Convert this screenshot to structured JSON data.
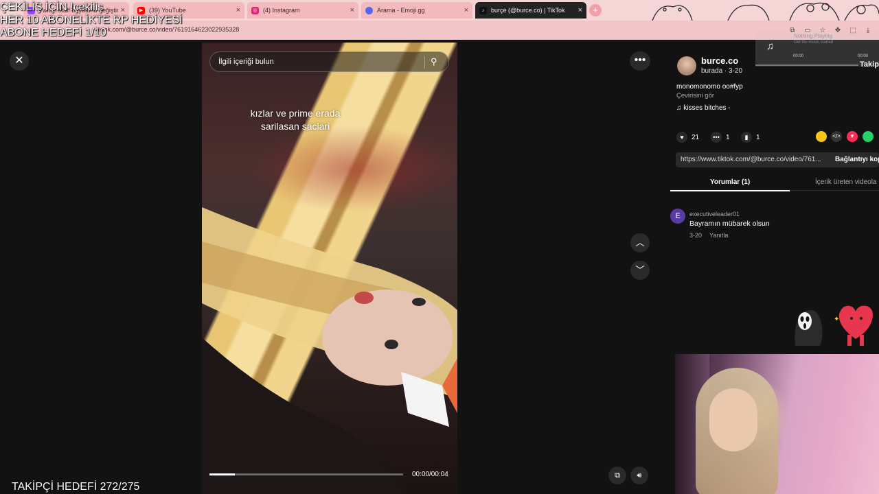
{
  "browser": {
    "tabs": [
      {
        "label": "Twitch staff boyutunu değiştir",
        "color": "#9146ff",
        "active": false
      },
      {
        "label": "(39) YouTube",
        "color": "#ff0000",
        "active": false
      },
      {
        "label": "(4) Instagram",
        "color": "#d62976",
        "active": false
      },
      {
        "label": "Arama - Emoji.gg",
        "color": "#5865f2",
        "active": false
      },
      {
        "label": "burçe (@burce.co) | TikTok",
        "color": "#111111",
        "active": true
      }
    ],
    "url": "tiktok.com/@burce.co/video/7619164623022935328",
    "close_glyph": "×",
    "new_tab": "+"
  },
  "stream_overlay": {
    "lines": [
      "ÇEKİLİŞ İÇİN !çekiliş",
      "HER 10 ABONELİKTE RP HEDİYESİ",
      "ABONE HEDEFİ 1/10"
    ],
    "follower_goal": "TAKİPÇİ HEDEFİ 272/275"
  },
  "now_playing": {
    "title": "Nothing Playing",
    "subtitle": "Get the music started",
    "time_left": "00:00",
    "time_right": "00:00"
  },
  "viewer": {
    "search_placeholder": "İlgili içeriği bulun",
    "caption_line1": "kızlar ve prime erada",
    "caption_line2": "sarilasan saclari",
    "time": "00:00/00:04",
    "progress": 0.13
  },
  "creator": {
    "username": "burce.co",
    "meta": "burada · 3-20",
    "description": "monomonomo oo#fyp",
    "translate": "Çevirisini gör",
    "music": "kisses bitches -",
    "follow": "Takip"
  },
  "stats": {
    "likes": "21",
    "comments": "1",
    "saves": "1"
  },
  "share": {
    "link": "https://www.tiktok.com/@burce.co/video/761...",
    "copy_label": "Bağlantıyı kop"
  },
  "panel_tabs": {
    "comments": "Yorumlar (1)",
    "creator_videos": "İçerik üreten videola"
  },
  "comment": {
    "avatar_letter": "E",
    "user": "executiveleader01",
    "text": "Bayramın mübarek olsun",
    "date": "3-20",
    "reply": "Yanıtla"
  },
  "icons": {
    "close": "close-icon",
    "more": "more-icon",
    "up": "chevron-up-icon",
    "down": "chevron-down-icon",
    "search": "search-icon",
    "volume": "volume-icon",
    "pip": "pip-icon",
    "music": "music-note-icon",
    "heart": "heart-icon",
    "comment": "comment-icon",
    "bookmark": "bookmark-icon"
  }
}
